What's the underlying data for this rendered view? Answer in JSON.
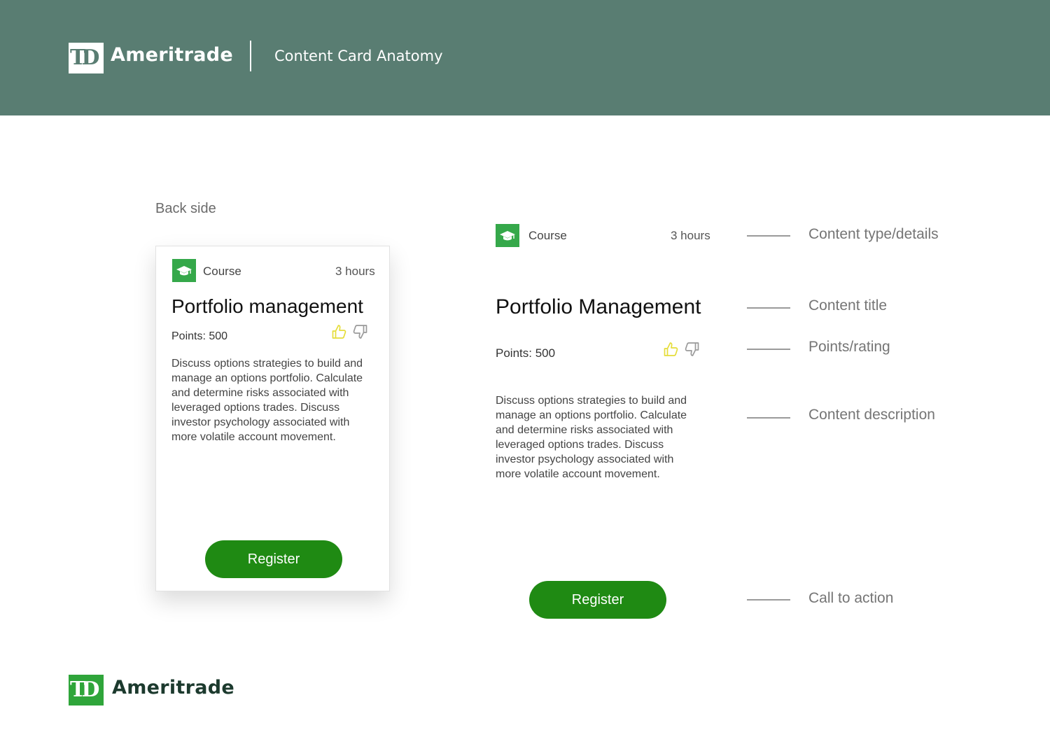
{
  "header": {
    "brand": "Ameritrade",
    "logo_mark": "TD",
    "title": "Content Card Anatomy"
  },
  "section_label": "Back side",
  "card_small": {
    "type_label": "Course",
    "duration": "3 hours",
    "title": "Portfolio management",
    "points": "Points: 500",
    "description": "Discuss options strategies to build and manage an options portfolio. Calculate and determine risks associated with leveraged options trades. Discuss investor psychology associated with more volatile account movement.",
    "cta": "Register"
  },
  "card_large": {
    "type_label": "Course",
    "duration": "3 hours",
    "title": "Portfolio Management",
    "points": "Points: 500",
    "description": "Discuss options strategies to build and manage an options portfolio. Calculate and determine risks associated with leveraged options trades. Discuss investor psychology associated with more volatile account movement.",
    "cta": "Register"
  },
  "annotations": {
    "type_details": "Content type/details",
    "title": "Content title",
    "points_rating": "Points/rating",
    "description": "Content description",
    "cta": "Call to action"
  },
  "footer": {
    "brand": "Ameritrade",
    "logo_mark": "TD"
  },
  "colors": {
    "header_bg": "#597d72",
    "brand_green": "#2fa53a",
    "cta_green": "#1f8a13",
    "footer_text": "#1c3a2e",
    "thumbs_up": "#e5dd3a",
    "thumbs_down": "#9a9a9a"
  },
  "icons": [
    "graduation-cap-icon",
    "thumbs-up-icon",
    "thumbs-down-icon"
  ]
}
